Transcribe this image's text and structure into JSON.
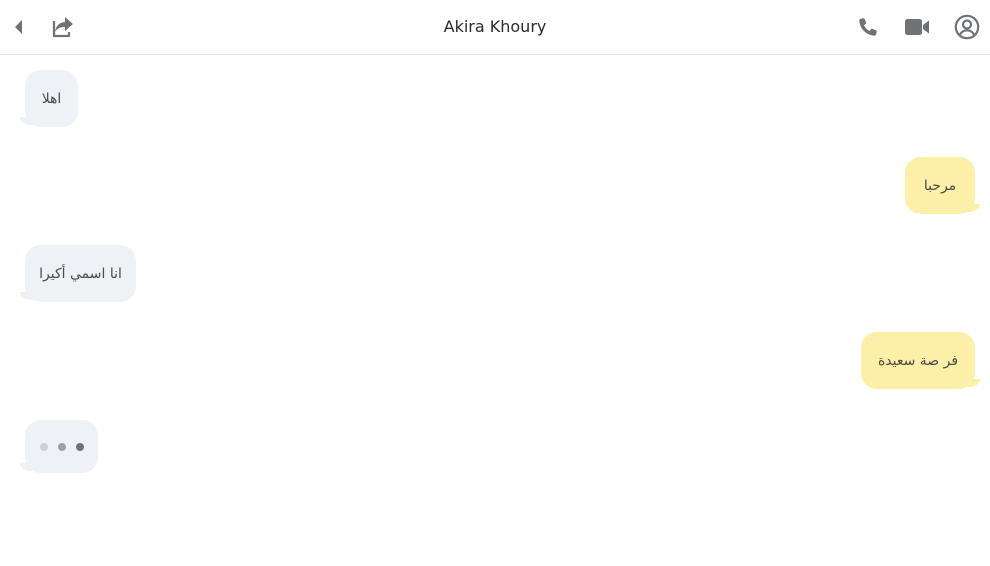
{
  "header": {
    "title": "Akira Khoury",
    "icons": [
      "back-arrow-icon",
      "share-icon",
      "phone-icon",
      "video-camera-icon",
      "profile-icon"
    ]
  },
  "messages": [
    {
      "direction": "incoming",
      "text": "اهلا"
    },
    {
      "direction": "outgoing",
      "text": "مرحبا"
    },
    {
      "direction": "incoming",
      "text": "انا اسمي أكيرا"
    },
    {
      "direction": "outgoing",
      "text": "فر صة سعيدة"
    }
  ],
  "typing_indicator": {
    "visible": true
  },
  "colors": {
    "incoming_bubble": "#eef1f5",
    "outgoing_bubble": "#fcf0a8",
    "icon": "#6f7378",
    "text": "#4a4a4a"
  }
}
